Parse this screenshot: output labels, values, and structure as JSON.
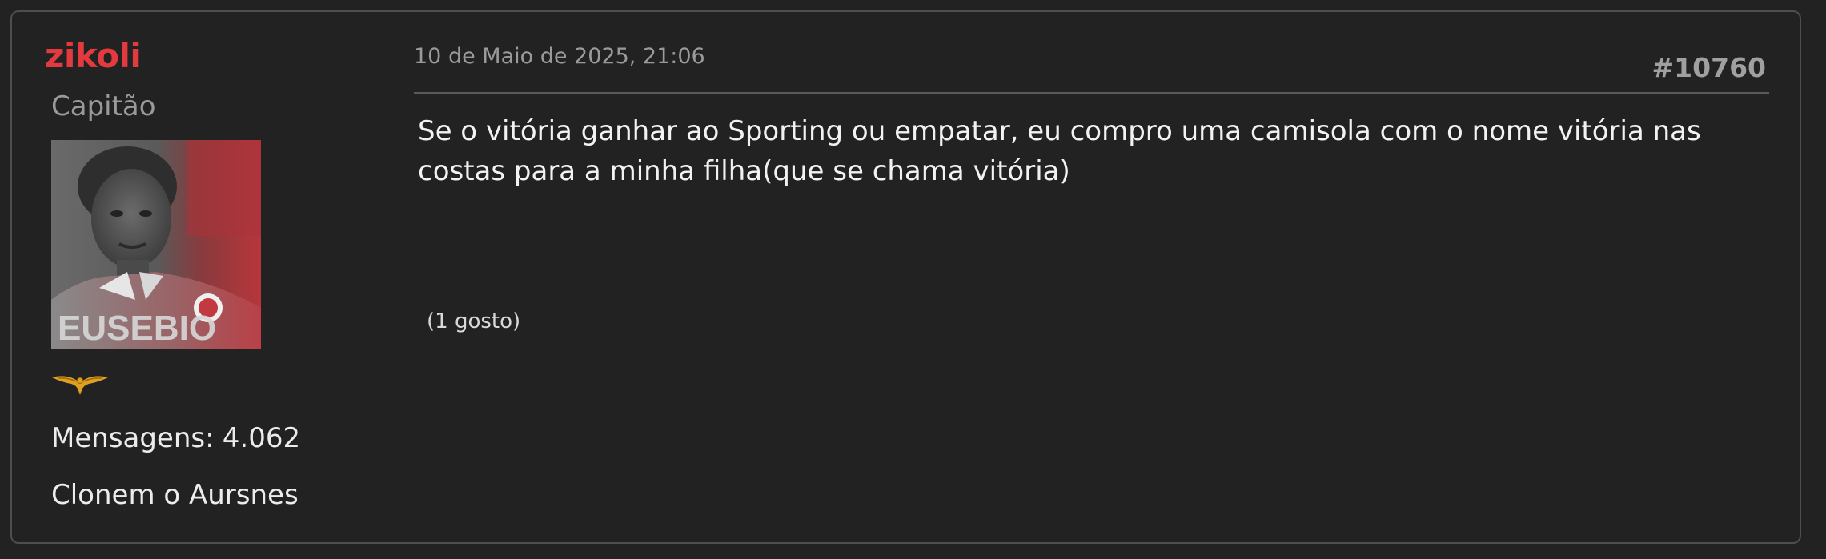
{
  "post": {
    "author": {
      "username": "zikoli",
      "rank": "Capitão",
      "avatar_caption": "EUSEBIO",
      "rank_badge_icon": "eagle-icon",
      "messages_label": "Mensagens:",
      "messages_count": "4.062",
      "signature": "Clonem o Aursnes"
    },
    "date": "10 de Maio de 2025, 21:06",
    "number": "#10760",
    "body": "Se o vitória ganhar ao Sporting ou empatar, eu compro uma camisola com o nome vitória nas costas para a minha filha(que se chama vitória)",
    "likes": "(1 gosto)"
  },
  "colors": {
    "background": "#222222",
    "border": "#4e4e4e",
    "username": "#e23a3f",
    "muted": "#9a9a9a",
    "text": "#f2f2f2",
    "badge_gold": "#e0a020"
  }
}
